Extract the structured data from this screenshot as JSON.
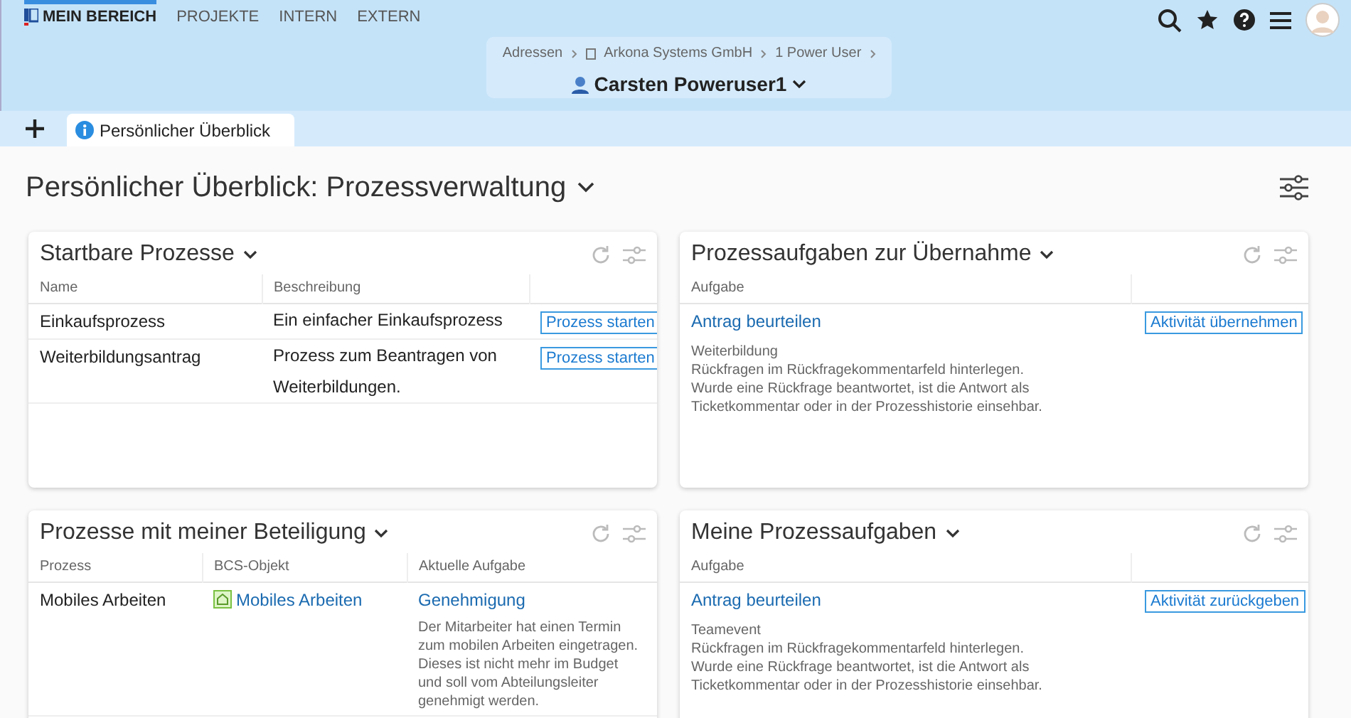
{
  "top_nav": [
    {
      "label": "MEIN BEREICH",
      "selected": true
    },
    {
      "label": "PROJEKTE",
      "selected": false
    },
    {
      "label": "INTERN",
      "selected": false
    },
    {
      "label": "EXTERN",
      "selected": false
    }
  ],
  "breadcrumb": [
    "Adressen",
    "Arkona Systems GmbH",
    "1 Power User"
  ],
  "context_title": "Carsten Poweruser1",
  "tabs": [
    {
      "label": "Persönlicher Überblick",
      "selected": true
    }
  ],
  "page_title": "Persönlicher Überblick: Prozessverwaltung",
  "panels": [
    {
      "title": "Startbare Prozesse",
      "kind": "startable",
      "columns": [
        "Name",
        "Beschreibung"
      ],
      "rows": [
        {
          "name": "Einkaufsprozess",
          "description": "Ein einfacher Einkaufsprozess",
          "action": "Prozess starten"
        },
        {
          "name": "Weiterbildungsantrag",
          "description": "Prozess zum Beantragen von Weiterbildungen.",
          "action": "Prozess starten"
        }
      ]
    },
    {
      "title": "Prozessaufgaben zur Übernahme",
      "kind": "tasks",
      "columns": [
        "Aufgabe"
      ],
      "rows": [
        {
          "task": "Antrag beurteilen",
          "details": [
            "Weiterbildung",
            "Rückfragen im Rückfragekommentarfeld hinterlegen.",
            "Wurde eine Rückfrage beantwortet, ist die Antwort als",
            "Ticketkommentar oder in der Prozesshistorie einsehbar."
          ],
          "action": "Aktivität übernehmen"
        }
      ]
    },
    {
      "title": "Prozesse mit meiner Beteiligung",
      "kind": "involvement",
      "columns": [
        "Prozess",
        "BCS-Objekt",
        "Aktuelle Aufgabe"
      ],
      "rows": [
        {
          "process": "Mobiles Arbeiten",
          "object": "Mobiles Arbeiten",
          "task": "Genehmigung",
          "details": "Der Mitarbeiter hat einen Termin zum mobilen Arbeiten eingetragen. Dieses ist nicht mehr im Budget und soll vom Abteilungsleiter genehmigt werden."
        }
      ]
    },
    {
      "title": "Meine Prozessaufgaben",
      "kind": "tasks",
      "columns": [
        "Aufgabe"
      ],
      "rows": [
        {
          "task": "Antrag beurteilen",
          "details": [
            "Teamevent",
            "Rückfragen im Rückfragekommentarfeld hinterlegen.",
            "Wurde eine Rückfrage beantwortet, ist die Antwort als",
            "Ticketkommentar oder in der Prozesshistorie einsehbar."
          ],
          "action": "Aktivität zurückgeben"
        }
      ]
    }
  ]
}
